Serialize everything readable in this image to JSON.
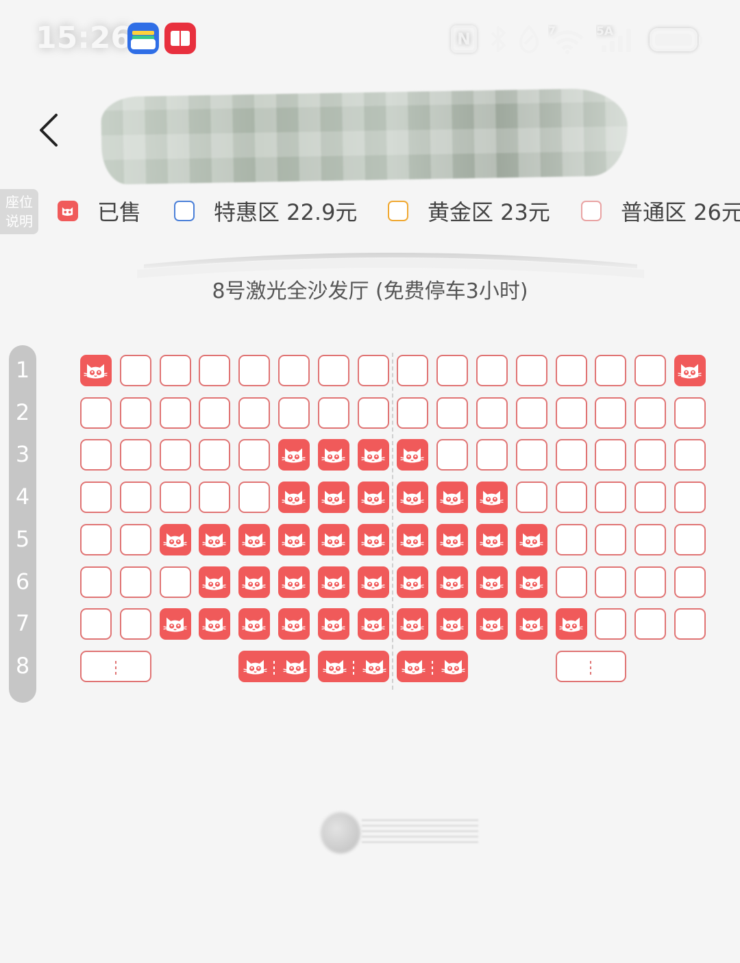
{
  "status_bar": {
    "time": "15:26",
    "nfc_label": "N",
    "wifi_badge": "7",
    "signal_badge": "5A",
    "icons": [
      "wallet-app-icon",
      "book-app-icon",
      "nfc-icon",
      "bluetooth-icon",
      "shield-icon",
      "wifi-icon",
      "signal-icon",
      "battery-icon"
    ]
  },
  "nav": {
    "back_icon": "chevron-left-icon"
  },
  "legend": {
    "tag_line1": "座位",
    "tag_line2": "说明",
    "items": [
      {
        "label": "已售",
        "color": "#f05a5a",
        "type": "sold"
      },
      {
        "label": "特惠区 22.9元",
        "color": "#4a7fd8",
        "type": "zone"
      },
      {
        "label": "黄金区 23元",
        "color": "#f0a830",
        "type": "zone"
      },
      {
        "label": "普通区 26元",
        "color": "#e07373",
        "type": "zone"
      }
    ]
  },
  "hall": {
    "name": "8号激光全沙发厅 (免费停车3小时)"
  },
  "rows": [
    "1",
    "2",
    "3",
    "4",
    "5",
    "6",
    "7",
    "8"
  ],
  "seat_map": {
    "columns": 16,
    "sold": [
      [
        1,
        16
      ],
      [],
      [
        6,
        7,
        8,
        9
      ],
      [
        6,
        7,
        8,
        9,
        10,
        11
      ],
      [
        3,
        4,
        5,
        6,
        7,
        8,
        9,
        10,
        11,
        12
      ],
      [
        4,
        5,
        6,
        7,
        8,
        9,
        10,
        11,
        12
      ],
      [
        3,
        4,
        5,
        6,
        7,
        8,
        9,
        10,
        11,
        12,
        13
      ],
      []
    ],
    "couple_row": {
      "row": "8",
      "pairs": [
        {
          "seats": [
            1,
            2
          ],
          "sold": false
        },
        {
          "seats": [
            5,
            6
          ],
          "sold": true
        },
        {
          "seats": [
            7,
            8
          ],
          "sold": true
        },
        {
          "seats": [
            9,
            10
          ],
          "sold": true
        },
        {
          "seats": [
            13,
            14
          ],
          "sold": false
        }
      ]
    }
  },
  "colors": {
    "sold": "#f05a5a",
    "seat_border": "#e07373",
    "background": "#f5f5f5"
  }
}
